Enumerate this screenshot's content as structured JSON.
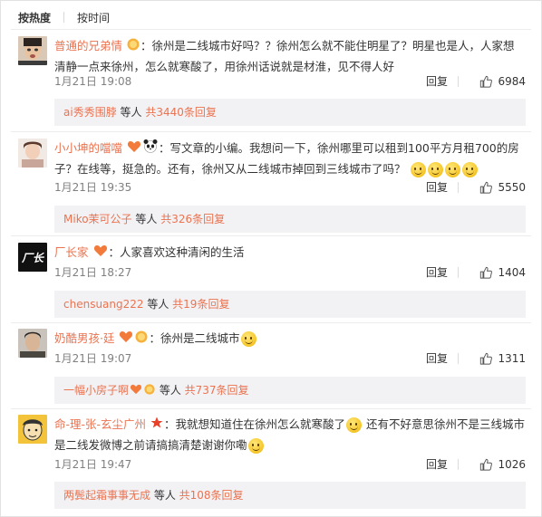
{
  "sort_tabs": {
    "hot": "按热度",
    "time": "按时间"
  },
  "colon": "：",
  "comments": [
    {
      "username": "普通的兄弟情",
      "text_parts": [
        "徐州是二线城市好吗？？徐州怎么就不能住明星了？明星也是人，人家想清静一点来徐州，怎么就寒酸了，用徐州话说就是材淮，见不得人好"
      ],
      "time": "1月21日 19:08",
      "reply_label": "回复",
      "likes": "6984",
      "reply_user": "ai秀秀围脖",
      "reply_mid": " 等人 ",
      "reply_count": "共3440条回复"
    },
    {
      "username": "小小坤的噹噹",
      "text_parts": [
        "写文章的小编。我想问一下，徐州哪里可以租到100平方月租700的房子？在线等，挺急的。还有，徐州又从二线城市掉回到三线城市了吗？"
      ],
      "time": "1月21日 19:35",
      "reply_label": "回复",
      "likes": "5550",
      "reply_user": "Miko茉可公子",
      "reply_mid": " 等人 ",
      "reply_count": "共326条回复"
    },
    {
      "username": "厂长家",
      "avatar_text": "厂长",
      "text_parts": [
        "人家喜欢这种清闲的生活"
      ],
      "time": "1月21日 18:27",
      "reply_label": "回复",
      "likes": "1404",
      "reply_user": "chensuang222",
      "reply_mid": " 等人 ",
      "reply_count": "共19条回复"
    },
    {
      "username": "奶酷男孩·廷",
      "text_parts": [
        "徐州是二线城市"
      ],
      "time": "1月21日 19:07",
      "reply_label": "回复",
      "likes": "1311",
      "reply_user": "一幅小房子啊",
      "reply_mid": " 等人 ",
      "reply_count": "共737条回复"
    },
    {
      "username": "命-理-张-玄尘广州",
      "text_parts": [
        "我就想知道住在徐州怎么就寒酸了",
        "还有不好意思徐州不是三线城市是二线发微博之前请搞搞清楚谢谢你嘞"
      ],
      "time": "1月21日 19:47",
      "reply_label": "回复",
      "likes": "1026",
      "reply_user": "两鬓起霜事事无成",
      "reply_mid": " 等人 ",
      "reply_count": "共108条回复"
    }
  ],
  "colors": {
    "username": "#eb7350",
    "text": "#333333",
    "meta": "#808080",
    "reply_bg": "#f2f2f5"
  }
}
